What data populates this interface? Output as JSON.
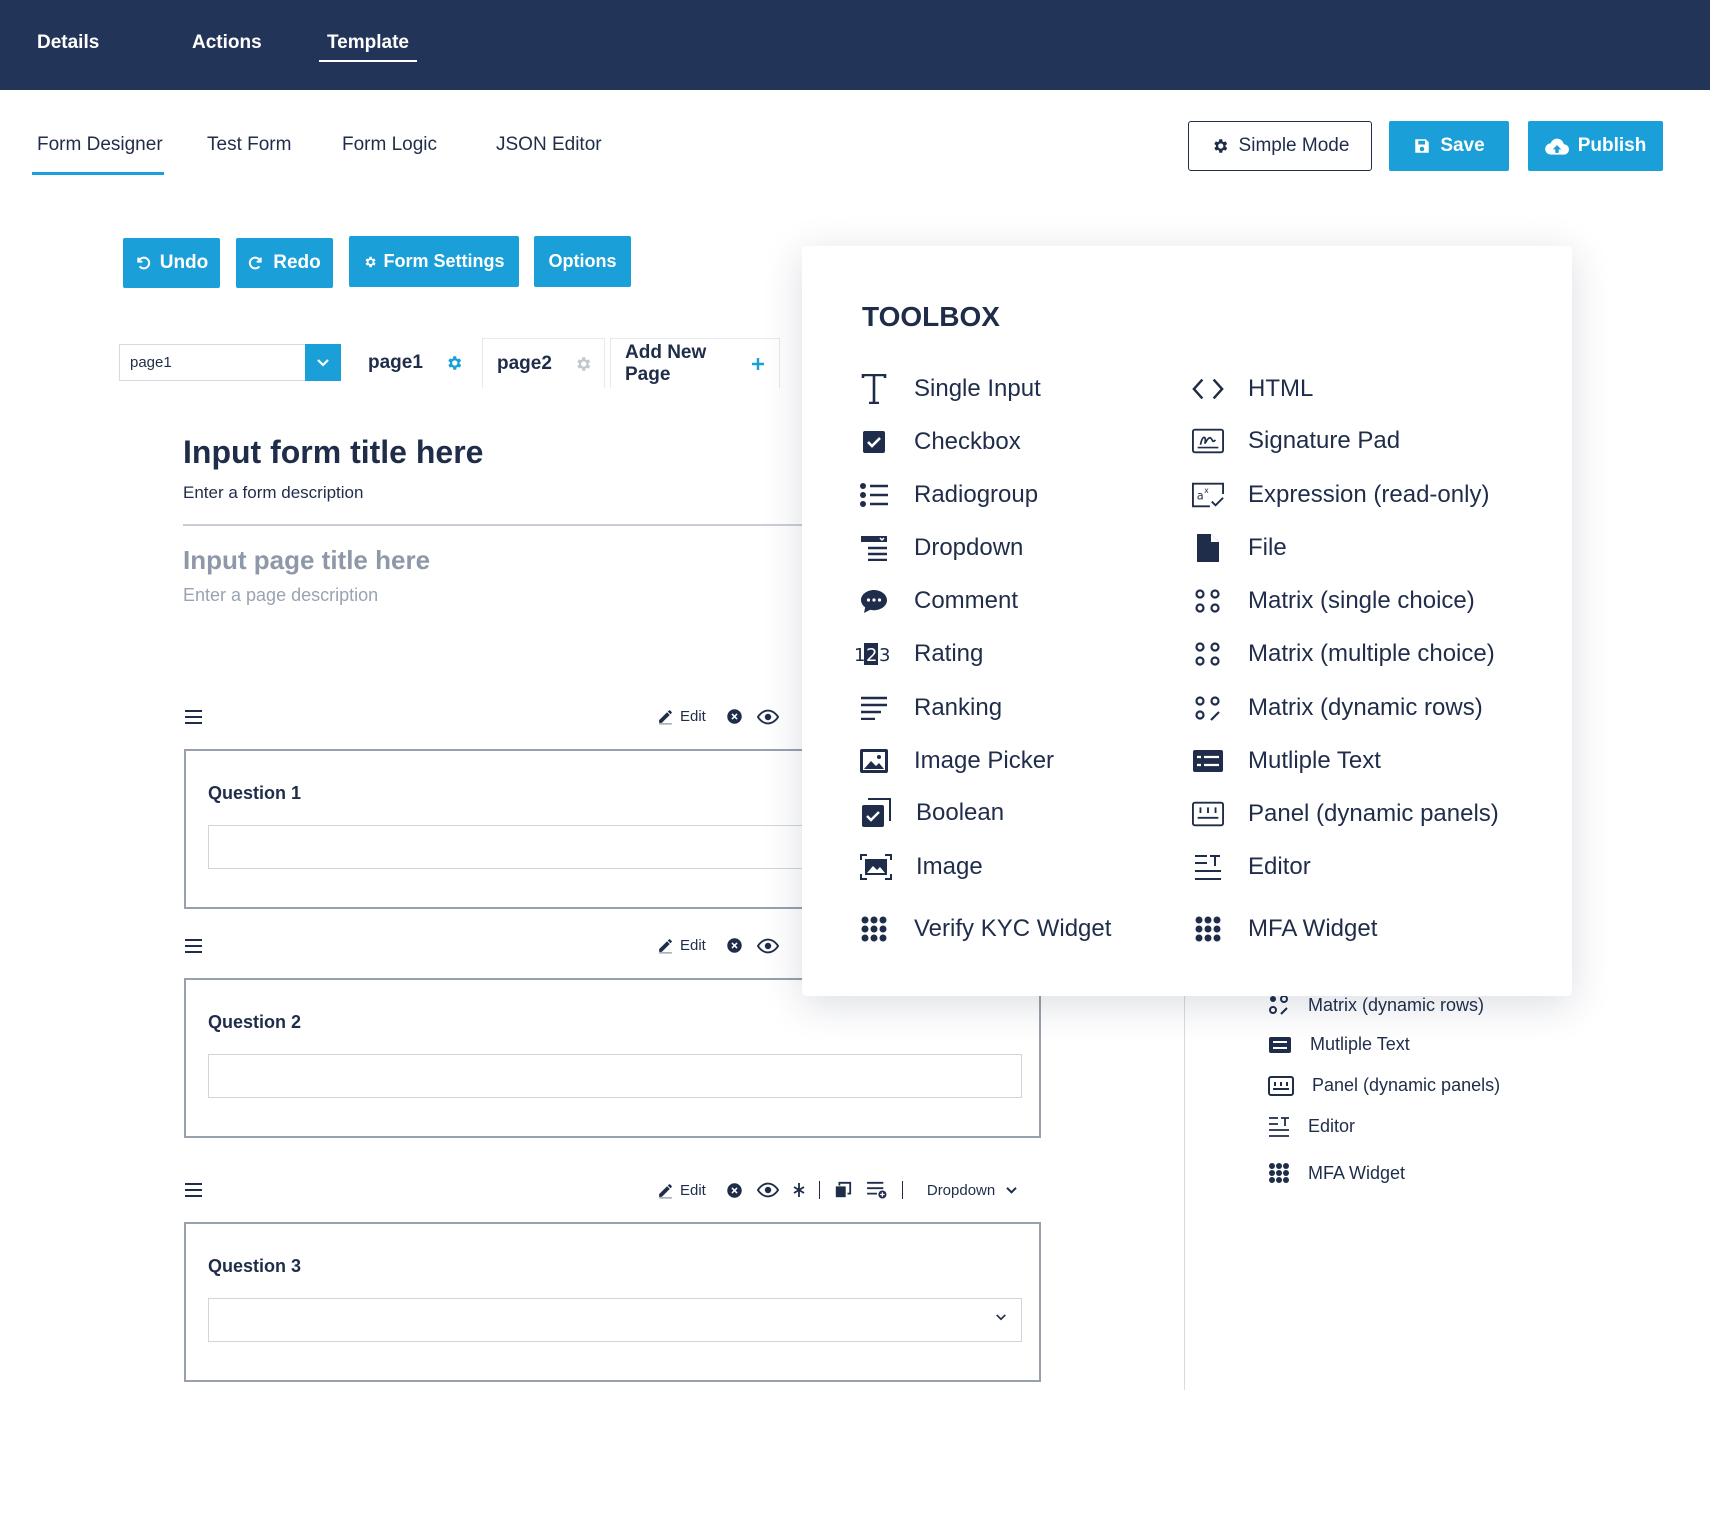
{
  "top_nav": {
    "tabs": [
      "Details",
      "Actions",
      "Template"
    ],
    "active": "Template"
  },
  "sub_nav": {
    "tabs": [
      "Form Designer",
      "Test Form",
      "Form Logic",
      "JSON Editor"
    ],
    "active": "Form Designer"
  },
  "header_actions": {
    "simple_mode": "Simple Mode",
    "save": "Save",
    "publish": "Publish"
  },
  "designer_toolbar": {
    "undo": "Undo",
    "redo": "Redo",
    "form_settings": "Form Settings",
    "options": "Options"
  },
  "pages": {
    "selector_value": "page1",
    "tabs": [
      "page1",
      "page2"
    ],
    "add_new": "Add New Page"
  },
  "form": {
    "title_placeholder": "Input form title here",
    "description_placeholder": "Enter a form description",
    "page_title_placeholder": "Input page title here",
    "page_description_placeholder": "Enter a page description"
  },
  "question_tools": {
    "edit": "Edit",
    "type_dropdown": "Dropdown"
  },
  "questions": [
    {
      "label": "Question 1",
      "type": "text"
    },
    {
      "label": "Question 2",
      "type": "text"
    },
    {
      "label": "Question 3",
      "type": "dropdown"
    }
  ],
  "background_toolbox": {
    "items": [
      "Matrix (dynamic rows)",
      "Mutliple Text",
      "Panel (dynamic panels)",
      "Editor",
      "MFA Widget"
    ]
  },
  "toolbox": {
    "title": "TOOLBOX",
    "left": [
      {
        "label": "Single Input",
        "icon": "text-icon"
      },
      {
        "label": "Checkbox",
        "icon": "checkbox-icon"
      },
      {
        "label": "Radiogroup",
        "icon": "radiogroup-icon"
      },
      {
        "label": "Dropdown",
        "icon": "dropdown-icon"
      },
      {
        "label": "Comment",
        "icon": "comment-icon"
      },
      {
        "label": "Rating",
        "icon": "rating-icon"
      },
      {
        "label": "Ranking",
        "icon": "ranking-icon"
      },
      {
        "label": "Image Picker",
        "icon": "image-picker-icon"
      },
      {
        "label": "Boolean",
        "icon": "boolean-icon"
      },
      {
        "label": "Image",
        "icon": "image-icon"
      },
      {
        "label": "Verify KYC Widget",
        "icon": "grid-icon"
      }
    ],
    "right": [
      {
        "label": "HTML",
        "icon": "code-icon"
      },
      {
        "label": "Signature Pad",
        "icon": "signature-icon"
      },
      {
        "label": "Expression (read-only)",
        "icon": "expression-icon"
      },
      {
        "label": "File",
        "icon": "file-icon"
      },
      {
        "label": "Matrix (single choice)",
        "icon": "matrix-icon"
      },
      {
        "label": "Matrix (multiple choice)",
        "icon": "matrix-icon"
      },
      {
        "label": "Matrix (dynamic rows)",
        "icon": "matrix-dynamic-icon"
      },
      {
        "label": "Mutliple Text",
        "icon": "multiple-text-icon"
      },
      {
        "label": "Panel (dynamic panels)",
        "icon": "panel-icon"
      },
      {
        "label": "Editor",
        "icon": "editor-icon"
      },
      {
        "label": "MFA Widget",
        "icon": "grid-icon"
      }
    ]
  },
  "colors": {
    "nav_bg": "#223559",
    "accent": "#1a9fd8",
    "text": "#1f2d4a"
  }
}
